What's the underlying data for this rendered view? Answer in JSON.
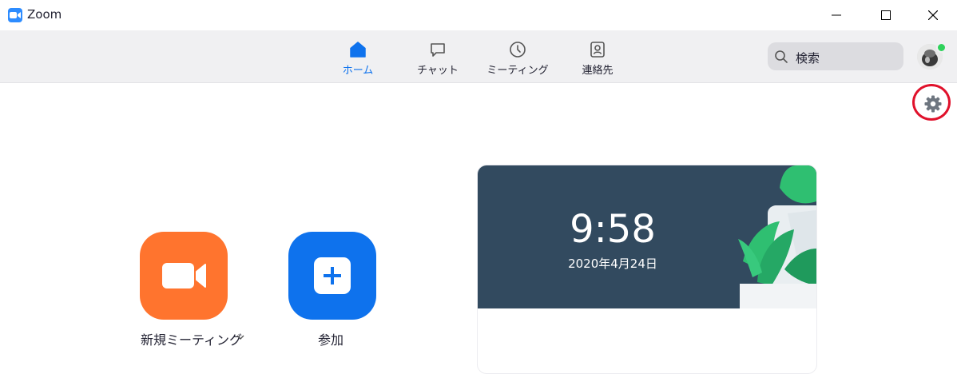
{
  "window": {
    "title": "Zoom"
  },
  "nav": {
    "tabs": [
      {
        "label": "ホーム",
        "icon": "home-icon",
        "active": true
      },
      {
        "label": "チャット",
        "icon": "chat-icon",
        "active": false
      },
      {
        "label": "ミーティング",
        "icon": "clock-icon",
        "active": false
      },
      {
        "label": "連絡先",
        "icon": "contacts-icon",
        "active": false
      }
    ],
    "search": {
      "placeholder": "検索"
    }
  },
  "actions": {
    "new_meeting": {
      "label": "新規ミーティング",
      "icon": "video-camera-icon",
      "color": "#ff742e"
    },
    "join": {
      "label": "参加",
      "icon": "plus-icon",
      "color": "#0e72ed"
    }
  },
  "card": {
    "time": "9:58",
    "date": "2020年4月24日"
  },
  "colors": {
    "accent": "#0e72ed",
    "highlight_ring": "#e0112b",
    "presence": "#2fd25b"
  }
}
